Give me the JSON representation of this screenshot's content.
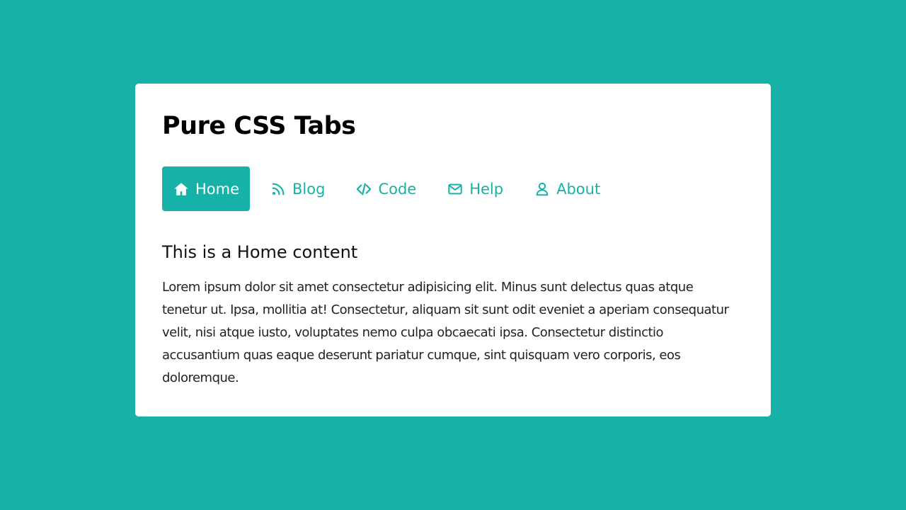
{
  "card": {
    "title": "Pure CSS Tabs"
  },
  "tabs": [
    {
      "label": "Home",
      "icon": "home-icon",
      "active": true
    },
    {
      "label": "Blog",
      "icon": "blog-icon",
      "active": false
    },
    {
      "label": "Code",
      "icon": "code-icon",
      "active": false
    },
    {
      "label": "Help",
      "icon": "envelope-icon",
      "active": false
    },
    {
      "label": "About",
      "icon": "user-icon",
      "active": false
    }
  ],
  "content": {
    "heading": "This is a Home content",
    "body": "Lorem ipsum dolor sit amet consectetur adipisicing elit. Minus sunt delectus quas atque tenetur ut. Ipsa, mollitia at! Consectetur, aliquam sit sunt odit eveniet a aperiam consequatur velit, nisi atque iusto, voluptates nemo culpa obcaecati ipsa. Consectetur distinctio accusantium quas eaque deserunt pariatur cumque, sint quisquam vero corporis, eos doloremque."
  },
  "colors": {
    "accent": "#16b2a7",
    "background": "#16b2a7",
    "card": "#ffffff"
  }
}
